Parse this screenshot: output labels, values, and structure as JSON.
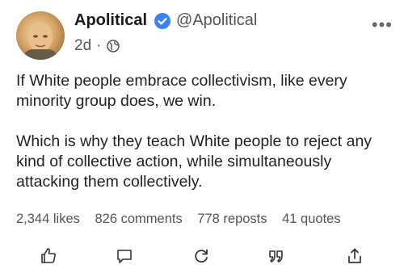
{
  "post": {
    "author": {
      "display_name": "Apolitical",
      "handle": "@Apolitical",
      "verified": true,
      "avatar_icon": "portrait-avatar"
    },
    "time": "2d",
    "separator": "·",
    "visibility_icon": "globe-icon",
    "more_label": "•••",
    "paragraphs": [
      "If White people embrace collectivism, like every minority group does, we win.",
      "Which is why they teach White people to reject any kind of collective action, while simultaneously attacking them collectively."
    ],
    "stats": {
      "likes": "2,344 likes",
      "comments": "826 comments",
      "reposts": "778 reposts",
      "quotes": "41 quotes"
    },
    "actions": [
      "like-icon",
      "comment-icon",
      "repost-icon",
      "quote-icon",
      "share-icon"
    ]
  },
  "colors": {
    "text": "#222222",
    "muted": "#555555",
    "verified": "#3b82f6"
  }
}
